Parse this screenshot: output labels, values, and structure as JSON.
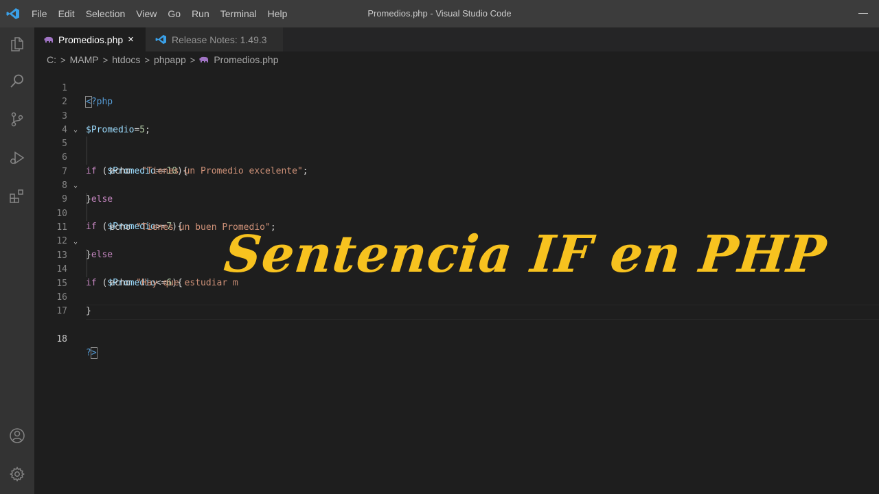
{
  "titlebar": {
    "app_icon": "vscode-logo-icon",
    "menu": [
      "File",
      "Edit",
      "Selection",
      "View",
      "Go",
      "Run",
      "Terminal",
      "Help"
    ],
    "title": "Promedios.php - Visual Studio Code"
  },
  "activity_bar": {
    "icons": [
      "explorer-icon",
      "search-icon",
      "source-control-icon",
      "run-debug-icon",
      "extensions-icon",
      "account-icon",
      "gear-icon"
    ]
  },
  "tabs": [
    {
      "label": "Promedios.php",
      "icon": "php-elephant-icon",
      "active": true,
      "close": "×"
    },
    {
      "label": "Release Notes: 1.49.3",
      "icon": "vscode-logo-icon",
      "active": false
    }
  ],
  "breadcrumb": {
    "items": [
      "C:",
      "MAMP",
      "htdocs",
      "phpapp",
      "Promedios.php"
    ],
    "separator": ">"
  },
  "editor": {
    "line_numbers": [
      "1",
      "2",
      "3",
      "4",
      "5",
      "6",
      "7",
      "8",
      "9",
      "10",
      "11",
      "12",
      "13",
      "14",
      "15",
      "16",
      "17",
      "18"
    ],
    "code": {
      "l1_a": "<",
      "l1_b": "?php",
      "l3_var": "$Promedio",
      "l3_op": "=",
      "l3_num": "5",
      "l3_end": ";",
      "l5_kw": "if",
      "l5_p": " (",
      "l5_var": "$Promedio",
      "l5_op": "==",
      "l5_num": "10",
      "l5_end": "){",
      "l6_kw": "echo",
      "l6_sp": "  ",
      "l6_str": "\"Tienes un Promedio excelente\"",
      "l6_end": ";",
      "l8_b": "}",
      "l8_kw": "else",
      "l9_kw": "if",
      "l9_p": " (",
      "l9_var": "$Promedio",
      "l9_op": ">=",
      "l9_num": "7",
      "l9_end": "){",
      "l10_kw": "echo",
      "l10_sp": " ",
      "l10_str": "\"Tienes un buen Promedio\"",
      "l10_end": ";",
      "l12_b": "}",
      "l12_kw": "else",
      "l13_kw": "if",
      "l13_p": " (",
      "l13_var": "$Promedio",
      "l13_op": "<=",
      "l13_num": "6",
      "l13_end": "){",
      "l14_kw": "echo",
      "l14_sp": " ",
      "l14_str": "\"Hay que estudiar m",
      "l16_b": "}",
      "l18_a": "?",
      "l18_b": ">"
    }
  },
  "overlay_text": "Sentencia IF en PHP",
  "colors": {
    "overlay": "#f7c21f",
    "keyword": "#c586c0",
    "variable": "#9cdcfe",
    "string": "#ce9178",
    "number": "#b5cea8"
  }
}
